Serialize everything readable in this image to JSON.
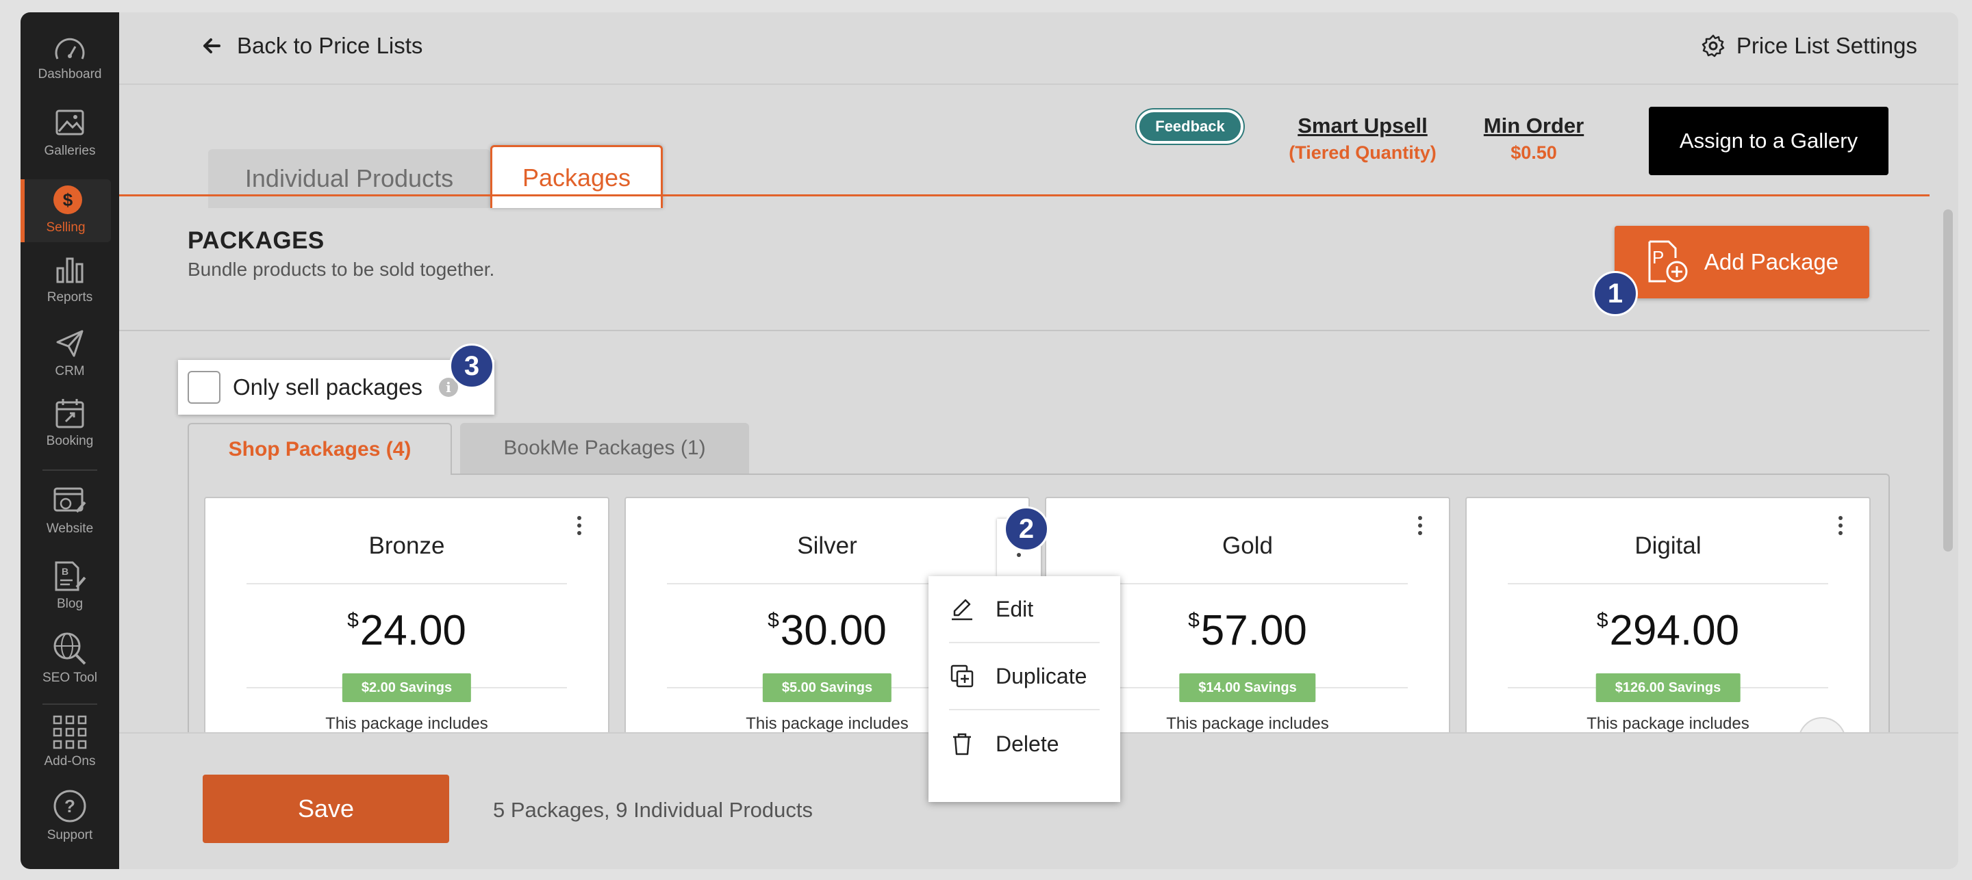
{
  "sidebar": {
    "items": [
      {
        "label": "Dashboard",
        "icon": "gauge-icon"
      },
      {
        "label": "Galleries",
        "icon": "image-icon"
      },
      {
        "label": "Selling",
        "icon": "dollar-icon",
        "active": true
      },
      {
        "label": "Reports",
        "icon": "bar-chart-icon"
      },
      {
        "label": "CRM",
        "icon": "paper-plane-icon"
      },
      {
        "label": "Booking",
        "icon": "calendar-icon"
      },
      {
        "label": "Website",
        "icon": "website-icon"
      },
      {
        "label": "Blog",
        "icon": "blog-icon"
      },
      {
        "label": "SEO Tool",
        "icon": "globe-search-icon"
      },
      {
        "label": "Add-Ons",
        "icon": "grid-icon"
      },
      {
        "label": "Support",
        "icon": "question-icon"
      }
    ]
  },
  "topbar": {
    "back_label": "Back to Price Lists",
    "settings_label": "Price List Settings"
  },
  "tabs": {
    "individual": "Individual Products",
    "packages": "Packages"
  },
  "header": {
    "feedback": "Feedback",
    "smart_upsell_title": "Smart Upsell",
    "smart_upsell_sub": "(Tiered Quantity)",
    "min_order_title": "Min Order",
    "min_order_value": "$0.50",
    "assign_label": "Assign to a Gallery"
  },
  "packages_section": {
    "title": "PACKAGES",
    "subtitle": "Bundle products to be sold together.",
    "add_label": "Add Package",
    "only_sell_label": "Only sell packages",
    "info": "i"
  },
  "badges": {
    "one": "1",
    "two": "2",
    "three": "3"
  },
  "subtabs": {
    "shop": "Shop Packages (4)",
    "bookme": "BookMe Packages (1)"
  },
  "cards": [
    {
      "name": "Bronze",
      "currency": "$",
      "price": "24.00",
      "savings": "$2.00 Savings",
      "desc": "This package includes"
    },
    {
      "name": "Silver",
      "currency": "$",
      "price": "30.00",
      "savings": "$5.00 Savings",
      "desc": "This package includes"
    },
    {
      "name": "Gold",
      "currency": "$",
      "price": "57.00",
      "savings": "$14.00 Savings",
      "desc": "This package includes"
    },
    {
      "name": "Digital",
      "currency": "$",
      "price": "294.00",
      "savings": "$126.00 Savings",
      "desc": "This package includes"
    }
  ],
  "menu": {
    "edit": "Edit",
    "duplicate": "Duplicate",
    "delete": "Delete"
  },
  "footer": {
    "save_label": "Save",
    "summary": "5 Packages, 9 Individual Products"
  },
  "colors": {
    "accent": "#e2622a",
    "sidebar_bg": "#202020",
    "badge": "#2a3f8a",
    "savings": "#7fbe6e",
    "feedback": "#2f7a7a"
  }
}
